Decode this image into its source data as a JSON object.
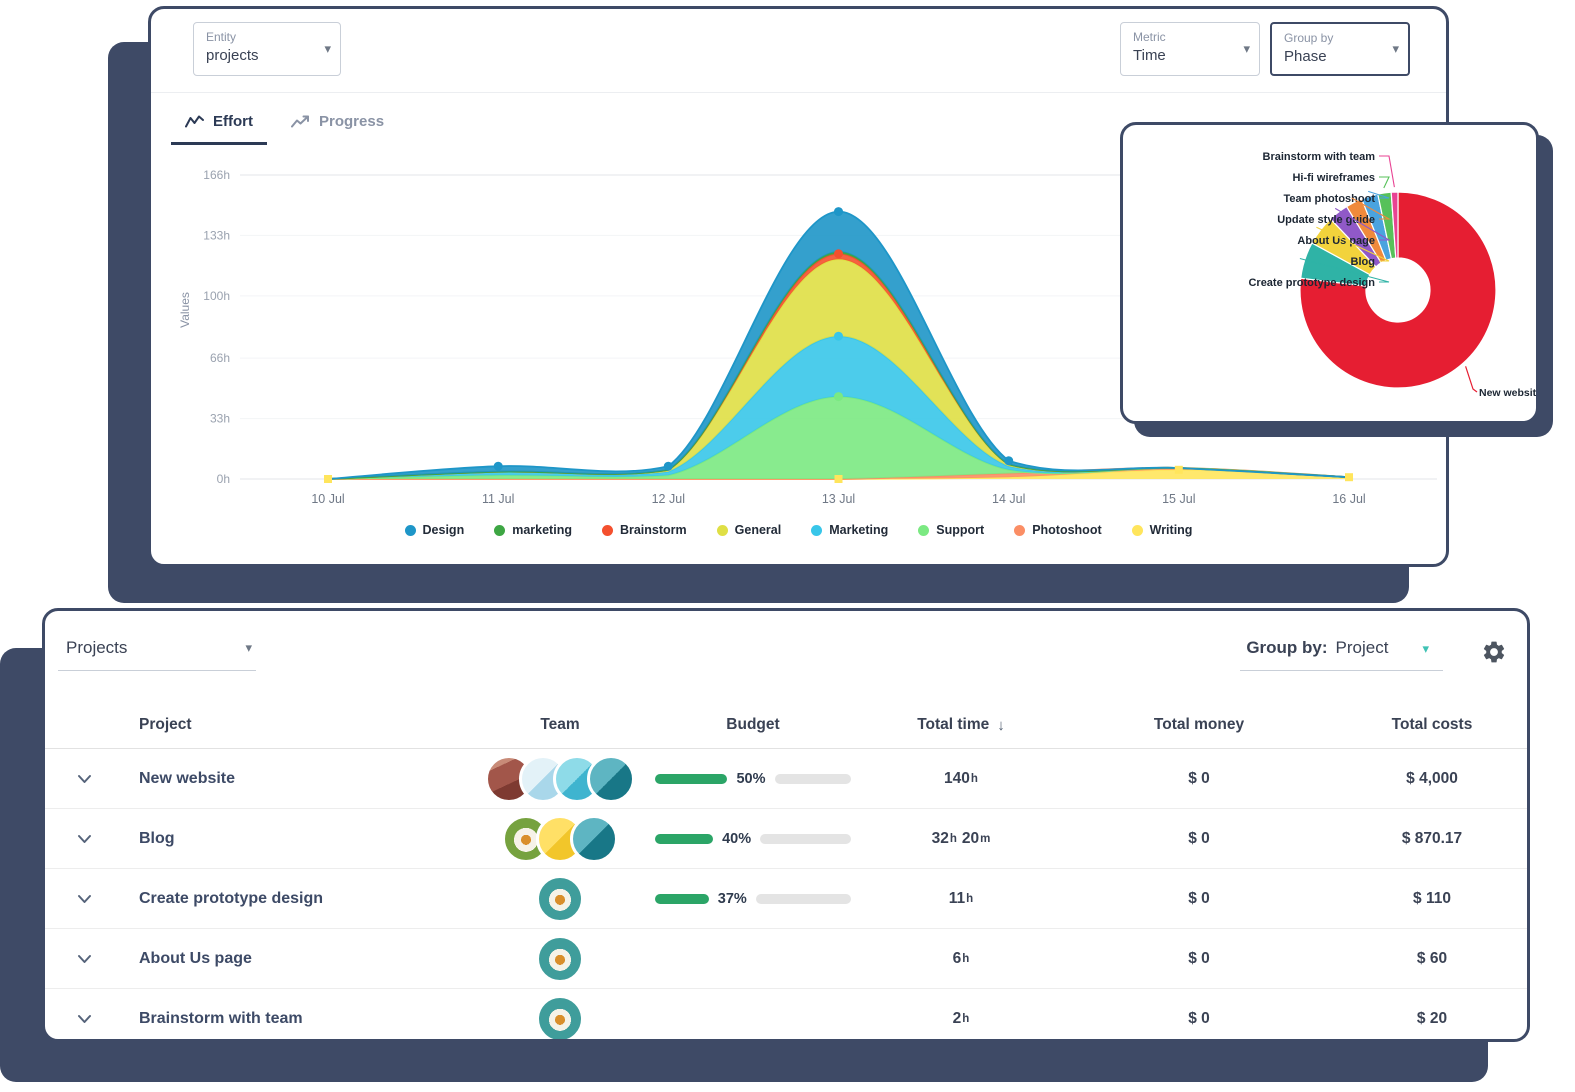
{
  "colors": {
    "accent_navy": "#3E4A66",
    "progress_green": "#2BA567",
    "teal_accent": "#3FC2B4",
    "donut_primary": "#E61E32"
  },
  "icons": {
    "caret": "▾",
    "sort_desc": "↓"
  },
  "top_card": {
    "entity_dropdown": {
      "label": "Entity",
      "value": "projects"
    },
    "metric_dropdown": {
      "label": "Metric",
      "value": "Time"
    },
    "groupby_dropdown": {
      "label": "Group by",
      "value": "Phase"
    },
    "tabs": [
      {
        "label": "Effort"
      },
      {
        "label": "Progress"
      }
    ]
  },
  "chart_data": [
    {
      "type": "area",
      "stacked": true,
      "title": "Effort",
      "ylabel": "Values",
      "x": [
        "10 Jul",
        "11 Jul",
        "12 Jul",
        "13 Jul",
        "14 Jul",
        "15 Jul",
        "16 Jul"
      ],
      "y_ticks": [
        "166h",
        "133h",
        "100h",
        "66h",
        "33h",
        "0h"
      ],
      "ylim": [
        0,
        166
      ],
      "grid": true,
      "legend_position": "bottom",
      "series": [
        {
          "name": "Writing",
          "color": "#FFE55C",
          "values": [
            0,
            0,
            0,
            0,
            1,
            5,
            1
          ],
          "marker": "square",
          "marker_points": [
            0,
            3,
            5,
            6
          ]
        },
        {
          "name": "Photoshoot",
          "color": "#FB8E65",
          "values": [
            0,
            0,
            0,
            0,
            2,
            1,
            0
          ]
        },
        {
          "name": "Support",
          "color": "#7BE982",
          "values": [
            0,
            2,
            2,
            45,
            2,
            0,
            0
          ],
          "marker": "circle",
          "marker_points": [
            3
          ]
        },
        {
          "name": "Marketing",
          "color": "#38C6E9",
          "values": [
            0,
            2,
            2,
            33,
            2,
            0,
            0
          ],
          "marker": "circle",
          "marker_points": [
            3
          ]
        },
        {
          "name": "General",
          "color": "#DFDF45",
          "values": [
            0,
            0,
            1,
            42,
            1,
            0,
            0
          ]
        },
        {
          "name": "Brainstorm",
          "color": "#F4502E",
          "values": [
            0,
            0,
            0,
            3,
            0,
            0,
            0
          ],
          "marker": "circle",
          "marker_points": [
            3
          ]
        },
        {
          "name": "marketing",
          "color": "#3DA643",
          "values": [
            0,
            0,
            0,
            1,
            0,
            0,
            0
          ]
        },
        {
          "name": "Design",
          "color": "#1E96C8",
          "values": [
            0,
            3,
            2,
            22,
            2,
            0,
            0
          ],
          "marker": "circle",
          "marker_points": [
            1,
            2,
            3,
            4
          ]
        }
      ],
      "legend": [
        "Design",
        "marketing",
        "Brainstorm",
        "General",
        "Marketing",
        "Support",
        "Photoshoot",
        "Writing"
      ]
    },
    {
      "type": "pie",
      "donut": true,
      "unit": "h",
      "segments": [
        {
          "label": "New website",
          "value": 140,
          "color": "#E61E32"
        },
        {
          "label": "Create prototype design",
          "value": 11,
          "color": "#2FB3A6"
        },
        {
          "label": "Blog",
          "value": 9,
          "color": "#F2D33C"
        },
        {
          "label": "About Us page",
          "value": 6,
          "color": "#9059C8"
        },
        {
          "label": "Update style guide",
          "value": 5,
          "color": "#F08A3C"
        },
        {
          "label": "Team photoshoot",
          "value": 5,
          "color": "#4AA3DF"
        },
        {
          "label": "Hi-fi wireframes",
          "value": 4,
          "color": "#57C15A"
        },
        {
          "label": "Brainstorm with team",
          "value": 2,
          "color": "#E84393"
        }
      ]
    }
  ],
  "bottom_card": {
    "entity_dropdown": {
      "value": "Projects"
    },
    "groupby": {
      "label": "Group by:",
      "value": "Project"
    },
    "columns": [
      "Project",
      "Team",
      "Budget",
      "Total time",
      "Total money",
      "Total costs"
    ],
    "sort_column": "Total time",
    "rows": [
      {
        "project": "New website",
        "avatars": [
          "photo-red",
          "split-blue",
          "split-cyan",
          "split-teal"
        ],
        "budget_pct": 50,
        "time": [
          [
            "140",
            "h"
          ]
        ],
        "money": "$ 0",
        "costs": "$ 4,000"
      },
      {
        "project": "Blog",
        "avatars": [
          "flower-green",
          "split-yellow",
          "split-teal"
        ],
        "budget_pct": 40,
        "time": [
          [
            "32",
            "h"
          ],
          [
            "20",
            "m"
          ]
        ],
        "money": "$ 0",
        "costs": "$ 870.17"
      },
      {
        "project": "Create prototype design",
        "avatars": [
          "flower-teal"
        ],
        "budget_pct": 37,
        "time": [
          [
            "11",
            "h"
          ]
        ],
        "money": "$ 0",
        "costs": "$ 110"
      },
      {
        "project": "About Us page",
        "avatars": [
          "flower-teal"
        ],
        "budget_pct": null,
        "time": [
          [
            "6",
            "h"
          ]
        ],
        "money": "$ 0",
        "costs": "$ 60"
      },
      {
        "project": "Brainstorm with team",
        "avatars": [
          "flower-teal"
        ],
        "budget_pct": null,
        "time": [
          [
            "2",
            "h"
          ]
        ],
        "money": "$ 0",
        "costs": "$ 20"
      }
    ]
  }
}
